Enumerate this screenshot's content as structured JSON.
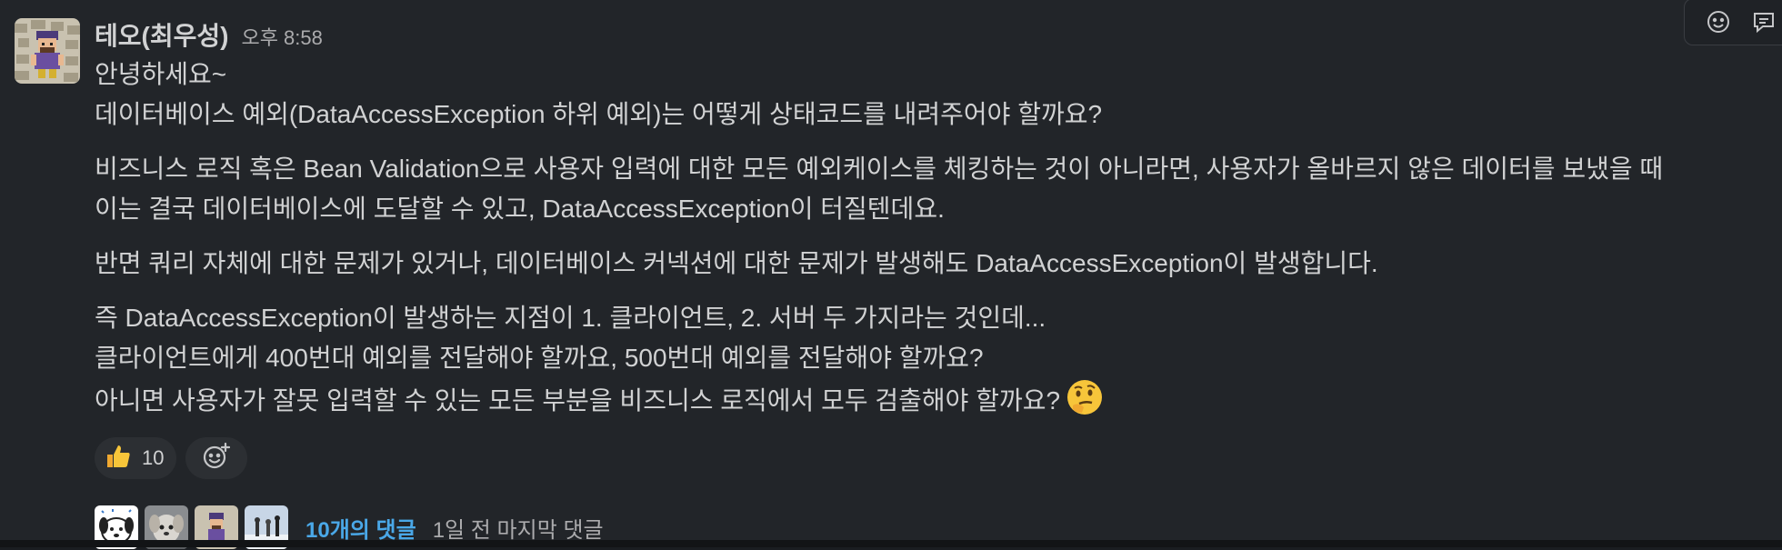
{
  "message": {
    "author": "테오(최우성)",
    "time": "오후 8:58",
    "lines": [
      "안녕하세요~",
      "데이터베이스 예외(DataAccessException 하위 예외)는 어떻게 상태코드를 내려주어야 할까요?",
      "비즈니스 로직 혹은 Bean Validation으로 사용자 입력에 대한 모든 예외케이스를 체킹하는 것이 아니라면, 사용자가 올바르지 않은 데이터를 보냈을 때",
      "이는 결국 데이터베이스에 도달할 수 있고,  DataAccessException이 터질텐데요.",
      "반면 쿼리 자체에 대한 문제가 있거나, 데이터베이스 커넥션에 대한 문제가 발생해도 DataAccessException이 발생합니다.",
      "즉 DataAccessException이 발생하는 지점이 1. 클라이언트, 2. 서버 두 가지라는 것인데...",
      "클라이언트에게 400번대 예외를 전달해야 할까요, 500번대 예외를 전달해야 할까요?",
      "아니면 사용자가 잘못 입력할 수 있는 모든 부분을 비즈니스 로직에서 모두 검출해야 할까요?"
    ],
    "trailing_emoji": "thinking-face-icon"
  },
  "reactions": [
    {
      "icon": "thumbs-up-icon",
      "count": "10"
    }
  ],
  "add_reaction_icon": "add-emoji-icon",
  "thread": {
    "avatars": [
      "avatar-dog-white",
      "avatar-dog-gray",
      "avatar-pixel-character",
      "avatar-people-snow"
    ],
    "replies_label": "10개의 댓글",
    "last_reply": "1일 전 마지막 댓글"
  },
  "colors": {
    "background": "#222529",
    "text": "#d1d2d3",
    "muted": "#ababad",
    "link": "#4aa8e8"
  }
}
